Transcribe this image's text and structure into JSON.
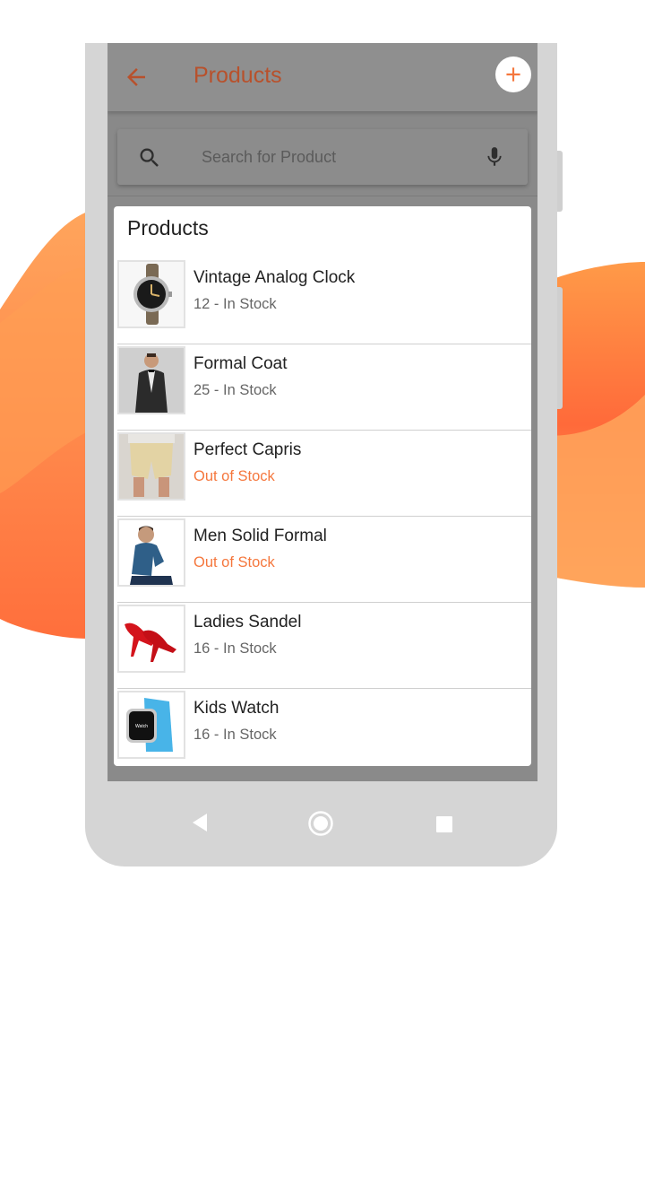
{
  "appbar": {
    "title": "Products",
    "back_icon": "arrow-left-icon",
    "add_icon": "plus-icon"
  },
  "search": {
    "placeholder": "Search for Product",
    "value": "",
    "search_icon": "search-icon",
    "mic_icon": "microphone-icon"
  },
  "card": {
    "title": "Products",
    "items": [
      {
        "name": "Vintage Analog Clock",
        "stock": "12 - In Stock",
        "in_stock": true,
        "image": "watch-image"
      },
      {
        "name": "Formal Coat",
        "stock": "25 - In Stock",
        "in_stock": true,
        "image": "coat-image"
      },
      {
        "name": "Perfect Capris",
        "stock": "Out of Stock",
        "in_stock": false,
        "image": "capris-image"
      },
      {
        "name": "Men Solid Formal",
        "stock": "Out of Stock",
        "in_stock": false,
        "image": "shirt-image"
      },
      {
        "name": "Ladies Sandel",
        "stock": "16 - In Stock",
        "in_stock": true,
        "image": "heels-image"
      },
      {
        "name": "Kids Watch",
        "stock": "16 - In Stock",
        "in_stock": true,
        "image": "smartwatch-image"
      }
    ]
  },
  "navbar": {
    "back_icon": "nav-back-icon",
    "home_icon": "nav-home-icon",
    "recents_icon": "nav-recents-icon"
  },
  "colors": {
    "accent": "#f5773d",
    "title_dim": "#b8512c",
    "blob_light": "#ffa55c",
    "blob_dark": "#ff6a3a"
  }
}
